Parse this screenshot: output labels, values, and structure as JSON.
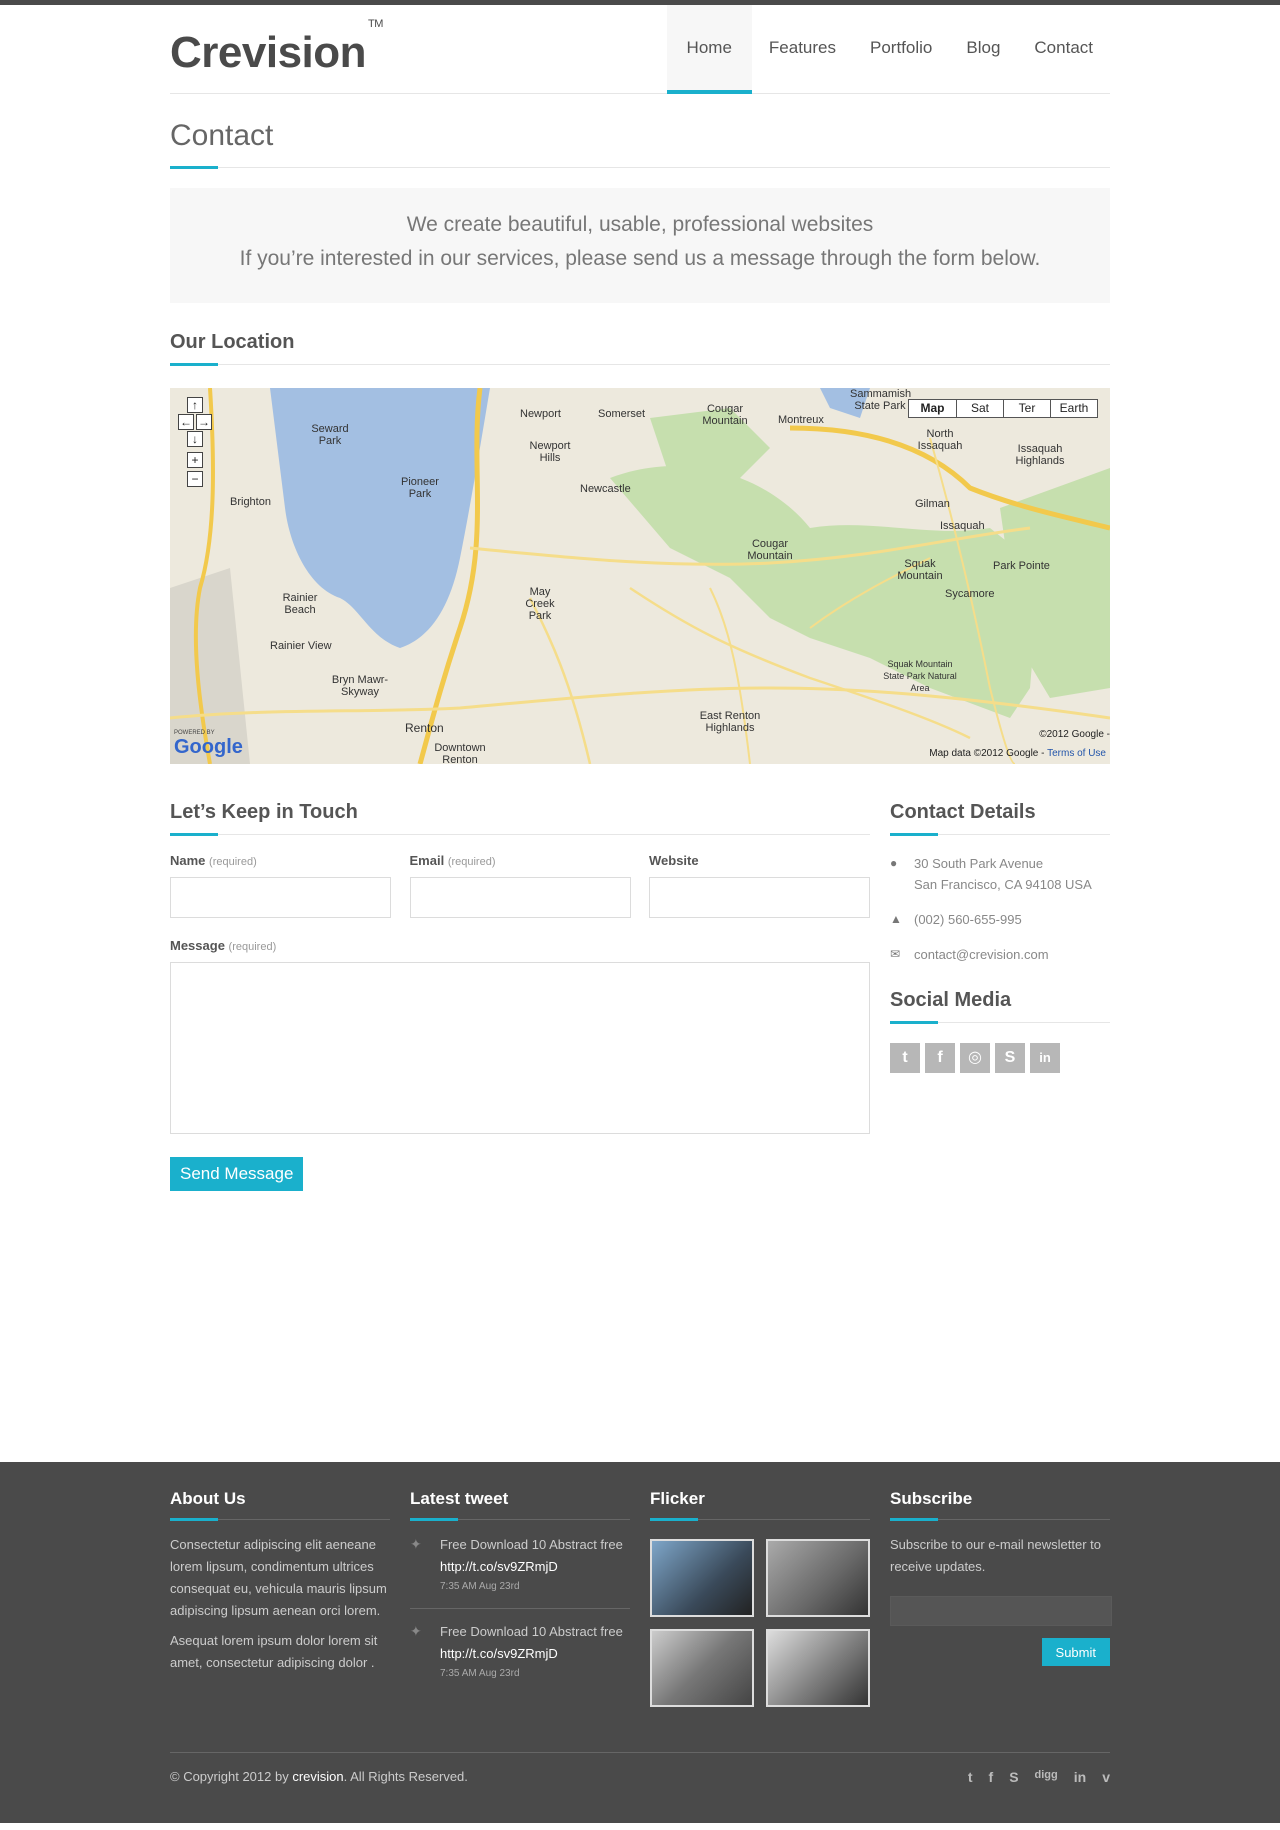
{
  "header": {
    "logo": "Crevision",
    "logo_tm": "TM",
    "nav": [
      "Home",
      "Features",
      "Portfolio",
      "Blog",
      "Contact"
    ]
  },
  "page": {
    "title": "Contact",
    "intro_line1": "We create beautiful, usable, professional websites",
    "intro_line2": "If you’re interested in our services, please send us a message through the form below."
  },
  "location": {
    "title": "Our Location",
    "map_types": [
      "Map",
      "Sat",
      "Ter",
      "Earth"
    ],
    "labels": [
      "Seward Park",
      "Brighton",
      "Pioneer Park",
      "Newport",
      "Somerset",
      "Cougar Mountain",
      "Montreux",
      "Sammamish State Park",
      "North Issaquah",
      "Issaquah Highlands",
      "Newport Hills",
      "Newcastle",
      "Gilman",
      "Issaquah",
      "Squak Mountain",
      "Park Pointe",
      "Sycamore",
      "Cougar Mountain",
      "Rainier Beach",
      "May Creek Park",
      "Rainier View",
      "Bryn Mawr-Skyway",
      "Renton",
      "Downtown Renton",
      "East Renton Highlands",
      "Squak Mountain State Park Natural Area"
    ],
    "powered": "POWERED BY",
    "google": "Google",
    "copyright": "©2012 Google -",
    "map_data": "Map data ©2012 Google -",
    "terms": "Terms of Use"
  },
  "form": {
    "title": "Let’s Keep in Touch",
    "name_label": "Name",
    "email_label": "Email",
    "website_label": "Website",
    "message_label": "Message",
    "required": "(required)",
    "send": "Send Message"
  },
  "details": {
    "title": "Contact Details",
    "address1": "30 South Park Avenue",
    "address2": "San Francisco, CA 94108 USA",
    "phone": "(002) 560-655-995",
    "email": "contact@crevision.com",
    "social_title": "Social Media",
    "social_icons": [
      "twitter-icon",
      "facebook-icon",
      "dribbble-icon",
      "skype-icon",
      "linkedin-icon"
    ]
  },
  "footer": {
    "about_title": "About Us",
    "about_p1": "Consectetur adipiscing elit aeneane lorem lipsum, condimentum ultrices consequat eu, vehicula mauris lipsum adipiscing lipsum aenean orci lorem.",
    "about_p2": "Asequat lorem ipsum dolor lorem sit amet, consectetur adipiscing dolor .",
    "tweet_title": "Latest tweet",
    "tweets": [
      {
        "text": "Free Download 10 Abstract free",
        "link": "http://t.co/sv9ZRmjD",
        "time": "7:35 AM Aug 23rd"
      },
      {
        "text": "Free Download 10 Abstract free",
        "link": "http://t.co/sv9ZRmjD",
        "time": "7:35 AM Aug 23rd"
      }
    ],
    "flickr_title": "Flicker",
    "subscribe_title": "Subscribe",
    "subscribe_text": "Subscribe to our e-mail newsletter to receive updates.",
    "subscribe_btn": "Submit",
    "copyright_pre": "© Copyright 2012 by ",
    "copyright_brand": "crevision",
    "copyright_post": ". All Rights Reserved.",
    "icons": [
      "twitter-icon",
      "facebook-icon",
      "skype-icon",
      "digg-icon",
      "linkedin-icon",
      "vimeo-icon"
    ]
  },
  "colors": {
    "accent": "#1ab0cc",
    "footer_bg": "#4a4a4a"
  }
}
